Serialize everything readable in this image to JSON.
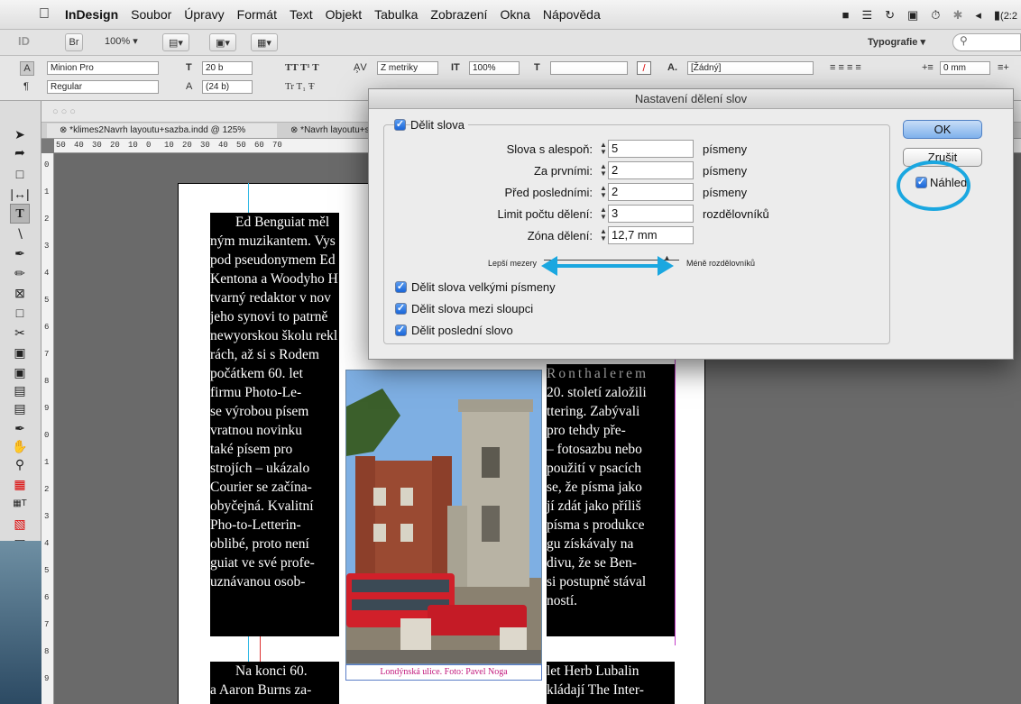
{
  "menubar": {
    "app": "InDesign",
    "items": [
      "Soubor",
      "Úpravy",
      "Formát",
      "Text",
      "Objekt",
      "Tabulka",
      "Zobrazení",
      "Okna",
      "Nápověda"
    ],
    "clock": "(2:2"
  },
  "appbar": {
    "zoom": "100% ▾",
    "bridge": "Br",
    "workspace": "Typografie ▾",
    "logo": "ID"
  },
  "control": {
    "font": "Minion Pro",
    "style": "Regular",
    "size": "20 b",
    "leading": "(24 b)",
    "kerning": "Z metriky",
    "scale": "100%",
    "charstyle": "[Žádný]",
    "indent": "0 mm"
  },
  "tabs": [
    "*klimes2Navrh layoutu+sazba.indd @ 125%",
    "*Navrh layoutu+s"
  ],
  "ruler": [
    "50",
    "40",
    "30",
    "20",
    "10",
    "0",
    "10",
    "20",
    "30",
    "40",
    "50",
    "60",
    "70"
  ],
  "vruler": [
    "0",
    "1",
    "2",
    "3",
    "4",
    "5",
    "6",
    "7",
    "8",
    "9",
    "0",
    "1",
    "2",
    "3",
    "4",
    "5",
    "6",
    "7",
    "8",
    "9"
  ],
  "article": {
    "left_col": [
      "Ed Benguiat měl",
      "ným muzikantem. Vys",
      "pod pseudonymem Ed",
      "Kentona a Woodyho H",
      "tvarný redaktor v nov",
      "jeho synovi to patrně",
      "newyorskou školu rekl",
      "rách, až si s Rodem",
      "počátkem 60. let",
      "firmu Photo-Le-",
      "se výrobou písem",
      "vratnou novinku",
      "také písem pro",
      "strojích – ukázalo",
      "Courier se začína-",
      "obyčejná. Kvalitní",
      "Pho-to-Letterin-",
      "oblibé, proto není",
      "guiat ve své profe-",
      "uznávanou osob-"
    ],
    "right_col": [
      "Ronthalerem",
      "20. století založili",
      "ttering. Zabývali",
      "pro tehdy pře-",
      "– fotosazbu nebo",
      "použití v psacích",
      "se, že písma jako",
      "jí zdát jako příliš",
      "písma s produkce",
      "gu získávaly na",
      "divu, že se Ben-",
      "si postupně stával",
      "ností."
    ],
    "bottom_left": [
      "Na konci 60.",
      "a Aaron Burns za-"
    ],
    "bottom_right": [
      "let Herb Lubalin",
      "kládají The Inter-"
    ],
    "caption": "Londýnská ulice. Foto: Pavel Noga"
  },
  "dialog": {
    "title": "Nastavení dělení slov",
    "hyphenate_label": "Dělit slova",
    "rows": [
      {
        "label": "Slova s alespoň:",
        "value": "5",
        "unit": "písmeny"
      },
      {
        "label": "Za prvními:",
        "value": "2",
        "unit": "písmeny"
      },
      {
        "label": "Před posledními:",
        "value": "2",
        "unit": "písmeny"
      },
      {
        "label": "Limit počtu dělení:",
        "value": "3",
        "unit": "rozdělovníků"
      },
      {
        "label": "Zóna dělení:",
        "value": "12,7 mm",
        "unit": ""
      }
    ],
    "slider_left": "Lepší mezery",
    "slider_right": "Méně rozdělovníků",
    "checks": [
      "Dělit slova velkými písmeny",
      "Dělit slova mezi sloupci",
      "Dělit poslední slovo"
    ],
    "ok": "OK",
    "cancel": "Zrušit",
    "preview": "Náhled"
  },
  "annotation_color": "#1aa7e0"
}
